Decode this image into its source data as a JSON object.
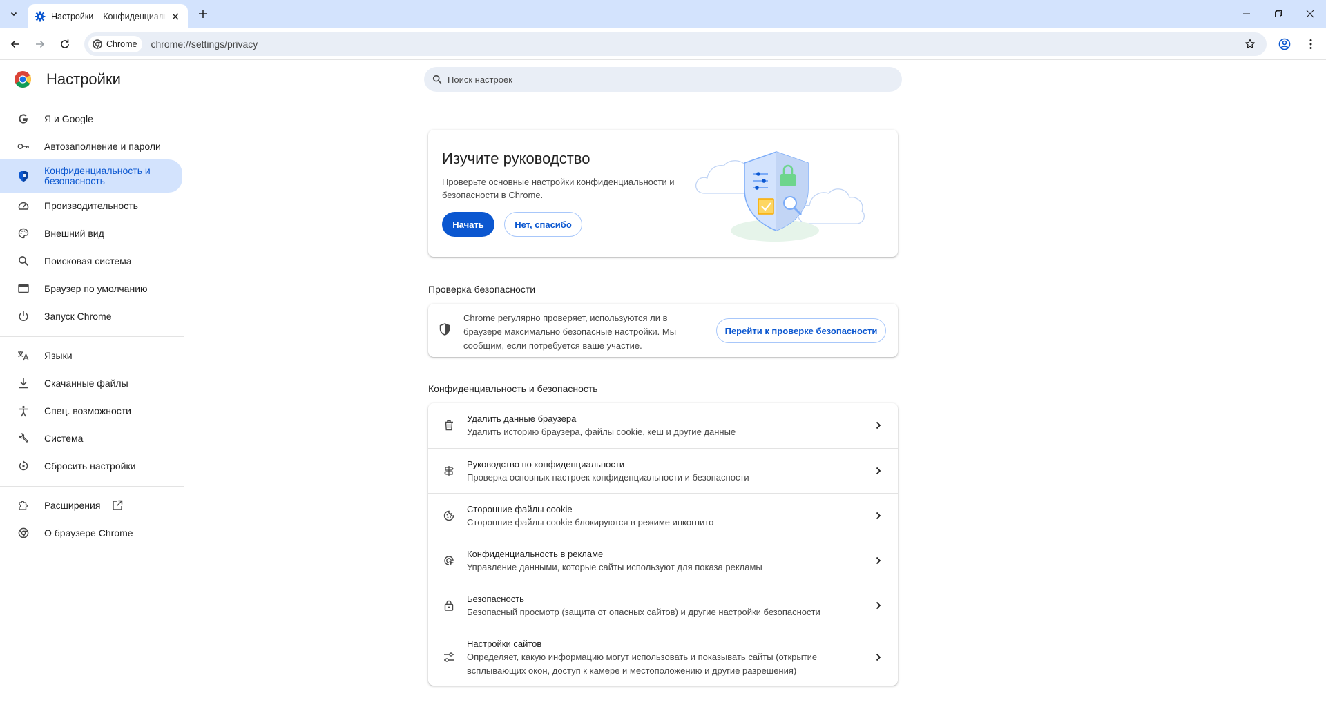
{
  "browser": {
    "tab_title": "Настройки – Конфиденциальность и безопасность",
    "chip_label": "Chrome",
    "url": "chrome://settings/privacy"
  },
  "sidebar": {
    "title": "Настройки",
    "items": [
      {
        "label": "Я и Google",
        "icon": "google-g-icon"
      },
      {
        "label": "Автозаполнение и пароли",
        "icon": "key-icon"
      },
      {
        "label": "Конфиденциальность и безопасность",
        "icon": "shield-icon"
      },
      {
        "label": "Производительность",
        "icon": "speedometer-icon"
      },
      {
        "label": "Внешний вид",
        "icon": "palette-icon"
      },
      {
        "label": "Поисковая система",
        "icon": "search-icon"
      },
      {
        "label": "Браузер по умолчанию",
        "icon": "browser-window-icon"
      },
      {
        "label": "Запуск Chrome",
        "icon": "power-icon"
      },
      {
        "label": "Языки",
        "icon": "translate-icon"
      },
      {
        "label": "Скачанные файлы",
        "icon": "download-icon"
      },
      {
        "label": "Спец. возможности",
        "icon": "accessibility-icon"
      },
      {
        "label": "Система",
        "icon": "wrench-icon"
      },
      {
        "label": "Сбросить настройки",
        "icon": "reset-icon"
      },
      {
        "label": "Расширения",
        "icon": "puzzle-icon"
      },
      {
        "label": "О браузере Chrome",
        "icon": "chrome-icon"
      }
    ]
  },
  "search": {
    "placeholder": "Поиск настроек"
  },
  "guide": {
    "title": "Изучите руководство",
    "description": "Проверьте основные настройки конфиденциальности и безопасности в Chrome.",
    "start_label": "Начать",
    "decline_label": "Нет, спасибо"
  },
  "safety_check": {
    "section_title": "Проверка безопасности",
    "text": "Chrome регулярно проверяет, используются ли в браузере максимально безопасные настройки. Мы сообщим, если потребуется ваше участие.",
    "button_label": "Перейти к проверке безопасности"
  },
  "privacy": {
    "section_title": "Конфиденциальность и безопасность",
    "rows": [
      {
        "title": "Удалить данные браузера",
        "subtitle": "Удалить историю браузера, файлы cookie, кеш и другие данные",
        "icon": "trash-icon"
      },
      {
        "title": "Руководство по конфиденциальности",
        "subtitle": "Проверка основных настроек конфиденциальности и безопасности",
        "icon": "signpost-icon"
      },
      {
        "title": "Сторонние файлы cookie",
        "subtitle": "Сторонние файлы cookie блокируются в режиме инкогнито",
        "icon": "cookie-icon"
      },
      {
        "title": "Конфиденциальность в рекламе",
        "subtitle": "Управление данными, которые сайты используют для показа рекламы",
        "icon": "ad-privacy-icon"
      },
      {
        "title": "Безопасность",
        "subtitle": "Безопасный просмотр (защита от опасных сайтов) и другие настройки безопасности",
        "icon": "lock-icon"
      },
      {
        "title": "Настройки сайтов",
        "subtitle": "Определяет, какую информацию могут использовать и показывать сайты (открытие всплывающих окон, доступ к камере и местоположению и другие разрешения)",
        "icon": "tune-icon"
      }
    ]
  },
  "colors": {
    "accent": "#0b57d0",
    "active_bg": "#d3e3fd",
    "omnibox_bg": "#e9eef6"
  }
}
